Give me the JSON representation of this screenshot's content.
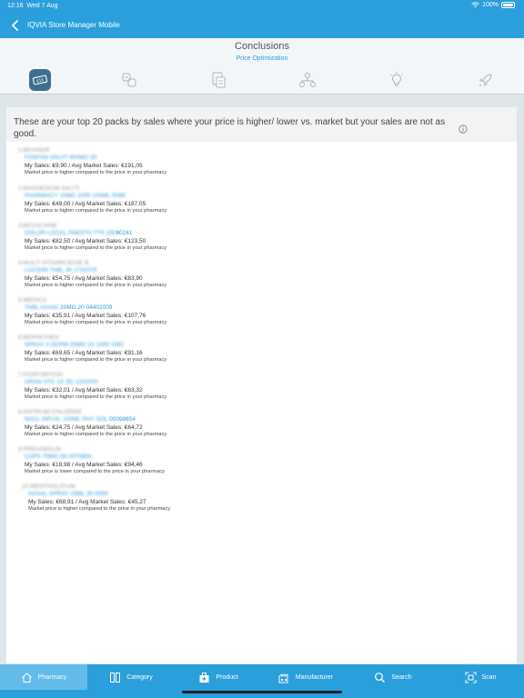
{
  "status": {
    "time": "12:16",
    "date": "Wed 7 Aug",
    "battery": "100%"
  },
  "nav": {
    "title": "IQVIA Store Manager Mobile"
  },
  "panel": {
    "title": "Conclusions",
    "subtitle": "Price Optimization"
  },
  "steps": [
    {
      "icon": "price-tag-icon",
      "active": true
    },
    {
      "icon": "pills-icon",
      "active": false
    },
    {
      "icon": "documents-icon",
      "active": false
    },
    {
      "icon": "network-icon",
      "active": false
    },
    {
      "icon": "lightbulb-icon",
      "active": false
    },
    {
      "icon": "rocket-icon",
      "active": false
    }
  ],
  "content": {
    "headline": "These are your top 20 packs by sales where your price is higher/ lower vs. market but your sales are not as good.",
    "items": [
      {
        "number": "1.",
        "name": "BEXINOR",
        "code_blur": "FOSFAN VALVT 900MG 30 ",
        "code_clear": "",
        "sales": "My Sales: €9,90 / Avg Market Sales: €191,05",
        "note": "Market price is higher compared to the price in your pharmacy"
      },
      {
        "number": "2.",
        "name": "MAGNESIUM SALTS",
        "code_blur": "PHARMACY 10MG 1000 100ML 0099",
        "code_clear": "",
        "sales": "My Sales: €49,00 / Avg Market Sales: €187,05",
        "note": "Market price is higher compared to the price in your pharmacy"
      },
      {
        "number": "3.",
        "name": "BECACAINE",
        "code_blur": "DOLOR LOCAL ANESTH TTS 200",
        "code_clear": "80241",
        "sales": "My Sales: €82,50 / Avg Market Sales: €123,50",
        "note": "Market price is higher compared to the price in your pharmacy"
      },
      {
        "number": "4.",
        "name": "MULTI VITAMIN BASE B",
        "code_blur": "LUCIDIN TABL 30 1742079",
        "code_clear": "",
        "sales": "My Sales: €54,75 / Avg Market Sales: €83,90",
        "note": "Market price is higher compared to the price in your pharmacy"
      },
      {
        "number": "5.",
        "name": "MEDICO",
        "code_blur": "TABL AAA42 ",
        "code_clear": "20MG 20 04402009",
        "sales": "My Sales: €35,91 / Avg Market Sales: €107,76",
        "note": "Market price is higher compared to the price in your pharmacy"
      },
      {
        "number": "6.",
        "name": "BEPANTHEN",
        "code_blur": "SPRAY 2 DERM 20MG 2X 1000 1997",
        "code_clear": "",
        "sales": "My Sales: €69,65 / Avg Market Sales: €91,16",
        "note": "Market price is higher compared to the price in your pharmacy"
      },
      {
        "number": "7.",
        "name": "FOSFOMYCIN",
        "code_blur": "GRAN STC 1X 3G 1202000",
        "code_clear": "",
        "sales": "My Sales: €32,01 / Avg Market Sales: €63,32",
        "note": "Market price is higher compared to the price in your pharmacy"
      },
      {
        "number": "8.",
        "name": "NATRIUM CHLORIDE",
        "code_blur": "NACL INFUS. 100ML PHY SOL ",
        "code_clear": "00099854",
        "sales": "My Sales: €24,75 / Avg Market Sales: €64,72",
        "note": "Market price is higher compared to the price in your pharmacy"
      },
      {
        "number": "9.",
        "name": "PREGABALIN",
        "code_blur": "CAPS 75MG 56 0070804",
        "code_clear": "",
        "sales": "My Sales: €18,98 / Avg Market Sales: €94,46",
        "note": "Market price is lower compared to the price in your pharmacy"
      },
      {
        "number": "10.",
        "name": "MENTHOLATUM",
        "code_blur": "NASAL SPRAY 15ML 30 0099",
        "code_clear": "",
        "sales": "My Sales: €68,91 / Avg Market Sales: €45,27",
        "note": "Market price is higher compared to the price in your pharmacy"
      }
    ]
  },
  "tabs": [
    {
      "label": "Pharmacy",
      "icon": "home-icon",
      "active": true
    },
    {
      "label": "Category",
      "icon": "category-icon",
      "active": false
    },
    {
      "label": "Product",
      "icon": "product-icon",
      "active": false
    },
    {
      "label": "Manufacturer",
      "icon": "factory-icon",
      "active": false
    },
    {
      "label": "Search",
      "icon": "search-icon",
      "active": false
    },
    {
      "label": "Scan",
      "icon": "scan-icon",
      "active": false
    }
  ],
  "colors": {
    "brand": "#2a9fdc",
    "active_step": "#3f6f8d",
    "active_tab": "#62bbe9"
  }
}
